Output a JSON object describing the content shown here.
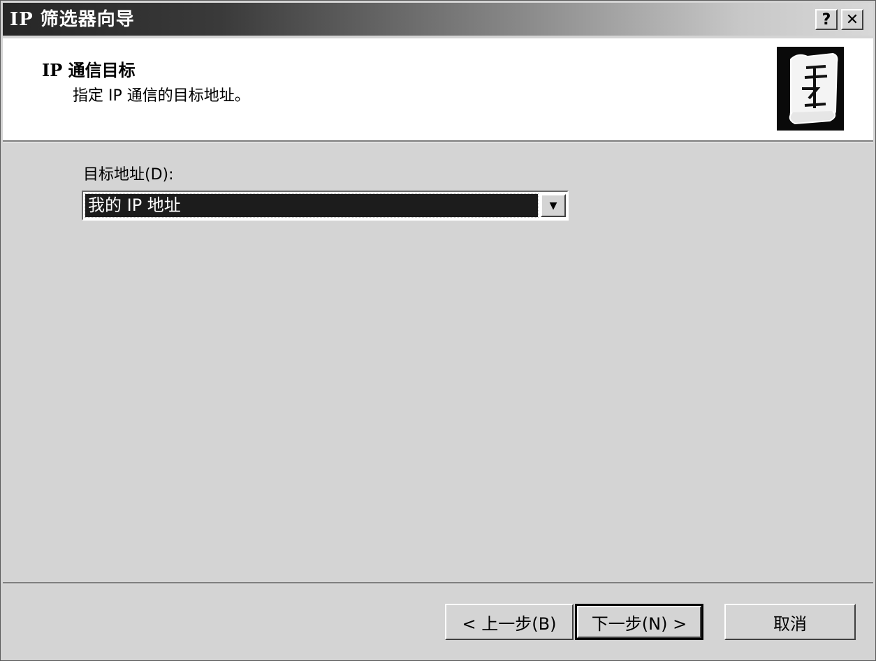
{
  "window": {
    "title": "IP 筛选器向导",
    "help_label": "?",
    "close_label": "✕"
  },
  "header": {
    "title": "IP 通信目标",
    "subtitle": "指定 IP 通信的目标地址。",
    "icon": "wizard-scroll-icon"
  },
  "form": {
    "dest_label": "目标地址(D):",
    "dest_value": "我的 IP 地址",
    "dropdown_arrow": "▼"
  },
  "buttons": {
    "back": "< 上一步(B)",
    "next": "下一步(N) >",
    "cancel": "取消"
  }
}
